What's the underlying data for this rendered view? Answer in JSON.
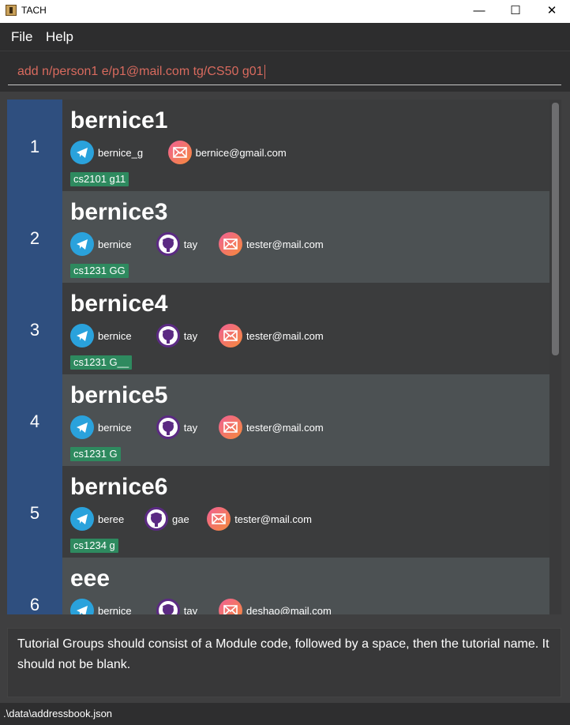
{
  "window": {
    "title": "TACH",
    "minimize_glyph": "—",
    "maximize_glyph": "☐",
    "close_glyph": "✕"
  },
  "menu": {
    "file": "File",
    "help": "Help"
  },
  "command": {
    "value": "add n/person1 e/p1@mail.com tg/CS50 g01"
  },
  "persons": [
    {
      "index": "1",
      "name": "bernice1",
      "telegram": "bernice_g",
      "github": "",
      "email": "bernice@gmail.com",
      "tag": "cs2101 g11"
    },
    {
      "index": "2",
      "name": "bernice3",
      "telegram": "bernice",
      "github": "tay",
      "email": "tester@mail.com",
      "tag": "cs1231 GG"
    },
    {
      "index": "3",
      "name": "bernice4",
      "telegram": "bernice",
      "github": "tay",
      "email": "tester@mail.com",
      "tag": "cs1231 G__"
    },
    {
      "index": "4",
      "name": "bernice5",
      "telegram": "bernice",
      "github": "tay",
      "email": "tester@mail.com",
      "tag": "cs1231 G"
    },
    {
      "index": "5",
      "name": "bernice6",
      "telegram": "beree",
      "github": "gae",
      "email": "tester@mail.com",
      "tag": "cs1234 g"
    },
    {
      "index": "6",
      "name": "eee",
      "telegram": "bernice",
      "github": "tay",
      "email": "deshao@mail.com",
      "tag": ""
    }
  ],
  "result": {
    "message": "Tutorial Groups should consist of a Module code, followed by a space, then the tutorial name. It should not be blank."
  },
  "status": {
    "path": ".\\data\\addressbook.json"
  },
  "icons": {
    "telegram": "telegram-icon",
    "github": "github-icon",
    "email": "email-icon"
  },
  "colors": {
    "index_bg": "#2f4f7f",
    "tag_bg": "#2e8a5f",
    "command_text": "#d86a5e"
  }
}
